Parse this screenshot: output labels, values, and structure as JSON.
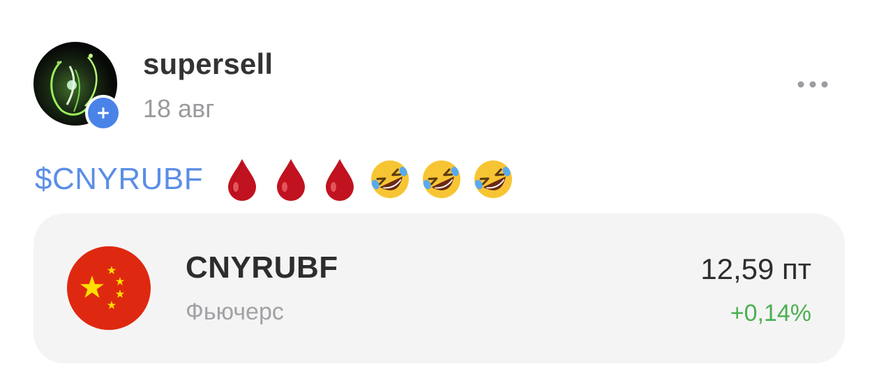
{
  "post": {
    "author": "supersell",
    "date": "18 авг",
    "ticker_link": "$CNYRUBF",
    "emojis": [
      "drop-of-blood",
      "drop-of-blood",
      "drop-of-blood",
      "rolling-on-floor-laughing",
      "rolling-on-floor-laughing",
      "rolling-on-floor-laughing"
    ]
  },
  "instrument_card": {
    "ticker": "CNYRUBF",
    "type": "Фьючерс",
    "price": "12,59 пт",
    "change": "+0,14%",
    "flag": "china-flag"
  },
  "colors": {
    "link": "#5b8ee6",
    "follow_badge": "#4a83e8",
    "positive_change": "#4caf50",
    "card_background": "#f4f4f5",
    "flag_red": "#de2910",
    "flag_yellow": "#ffde00"
  },
  "icons": {
    "more": "more-horizontal-icon",
    "follow": "plus-icon"
  }
}
